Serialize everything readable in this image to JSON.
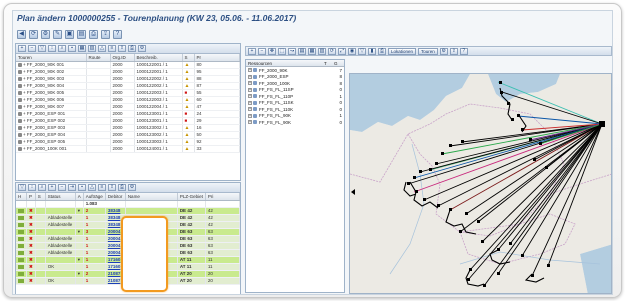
{
  "window": {
    "title": "Plan ändern 1000000255 - Tourenplanung (KW 23, 05.06. - 11.06.2017)"
  },
  "main_toolbar": {
    "buttons": [
      "back",
      "refresh",
      "settings",
      "tools",
      "save",
      "save-as",
      "print",
      "export",
      "help"
    ]
  },
  "tours_panel": {
    "headers": [
      "Touren",
      "Route",
      "Org.ID",
      "Beschreib.",
      "S",
      "Pr"
    ],
    "rows": [
      {
        "name": "FF_2000_90K 001",
        "route": "",
        "org": "2000",
        "desc": "1000122001 / 1",
        "status": "▲",
        "val": "80"
      },
      {
        "name": "FF_2000_90K 002",
        "route": "",
        "org": "2000",
        "desc": "1000122001 / 1",
        "status": "▲",
        "val": "95"
      },
      {
        "name": "FF_2000_90K 003",
        "route": "",
        "org": "2000",
        "desc": "1000122002 / 1",
        "status": "▲",
        "val": "88"
      },
      {
        "name": "FF_2000_90K 004",
        "route": "",
        "org": "2000",
        "desc": "1000122002 / 1",
        "status": "▲",
        "val": "87"
      },
      {
        "name": "FF_2000_90K 005",
        "route": "",
        "org": "2000",
        "desc": "1000122003 / 1",
        "status": "■",
        "val": "55"
      },
      {
        "name": "FF_2000_90K 006",
        "route": "",
        "org": "2000",
        "desc": "1000122003 / 1",
        "status": "▲",
        "val": "60"
      },
      {
        "name": "FF_2000_90K 007",
        "route": "",
        "org": "2000",
        "desc": "1000122004 / 1",
        "status": "▲",
        "val": "47"
      },
      {
        "name": "FF_2000_ESP 001",
        "route": "",
        "org": "2000",
        "desc": "1000123001 / 1",
        "status": "■",
        "val": "24"
      },
      {
        "name": "FF_2000_ESP 002",
        "route": "",
        "org": "2000",
        "desc": "1000123001 / 1",
        "status": "■",
        "val": "29"
      },
      {
        "name": "FF_2000_ESP 003",
        "route": "",
        "org": "2000",
        "desc": "1000123002 / 1",
        "status": "▲",
        "val": "16"
      },
      {
        "name": "FF_2000_ESP 004",
        "route": "",
        "org": "2000",
        "desc": "1000123002 / 1",
        "status": "▲",
        "val": "50"
      },
      {
        "name": "FF_2000_ESP 005",
        "route": "",
        "org": "2000",
        "desc": "1000123003 / 1",
        "status": "▲",
        "val": "92"
      },
      {
        "name": "FF_2000_100K 001",
        "route": "",
        "org": "2000",
        "desc": "1000124001 / 1",
        "status": "▲",
        "val": "33"
      }
    ]
  },
  "resources_panel": {
    "header": "Ressourcen",
    "header_cols": [
      "T",
      "G"
    ],
    "items": [
      {
        "name": "FF_2000_90K",
        "count": "7"
      },
      {
        "name": "FF_2000_ESP",
        "count": "8"
      },
      {
        "name": "FF_2000_100K",
        "count": "8"
      },
      {
        "name": "FF_FS_FL_11SP",
        "count": "0"
      },
      {
        "name": "FF_FS_FL_110P",
        "count": "1"
      },
      {
        "name": "FF_FS_FL_11SK",
        "count": "0"
      },
      {
        "name": "FF_FS_FL_110K",
        "count": "0"
      },
      {
        "name": "FF_FS_FL_90K",
        "count": "1"
      },
      {
        "name": "FF_FS_FL_90K",
        "count": "0"
      }
    ]
  },
  "map_toolbar": {
    "tabs": [
      "Lokationen",
      "Touren"
    ]
  },
  "orders_panel": {
    "headers": [
      "H",
      "P",
      "S",
      "Status",
      "A",
      "Aufträge",
      "Debitor",
      "Name",
      "PLZ-Gebiet",
      "Pri"
    ],
    "total": "1.083",
    "rows": [
      {
        "s": "",
        "status": "",
        "a": "2",
        "debitor": "38348",
        "plz": "DE 42",
        "pri": "42"
      },
      {
        "s": "",
        "status": "Abladestelle",
        "a": "1",
        "debitor": "38348",
        "plz": "DE 42",
        "pri": "42"
      },
      {
        "s": "",
        "status": "Abladestelle",
        "a": "1",
        "debitor": "38348",
        "plz": "DE 42",
        "pri": "42"
      },
      {
        "s": "",
        "status": "",
        "a": "3",
        "debitor": "20004",
        "plz": "DE 63",
        "pri": "63"
      },
      {
        "s": "",
        "status": "Abladestelle",
        "a": "1",
        "debitor": "20004",
        "plz": "DE 63",
        "pri": "63"
      },
      {
        "s": "",
        "status": "Abladestelle",
        "a": "1",
        "debitor": "20004",
        "plz": "DE 63",
        "pri": "63"
      },
      {
        "s": "",
        "status": "Abladestelle",
        "a": "1",
        "debitor": "20004",
        "plz": "DE 63",
        "pri": "63"
      },
      {
        "s": "",
        "status": "",
        "a": "1",
        "debitor": "17160",
        "plz": "AT 11",
        "pri": "11"
      },
      {
        "s": "",
        "status": "OK",
        "a": "1",
        "debitor": "17160",
        "plz": "AT 11",
        "pri": "11"
      },
      {
        "s": "",
        "status": "",
        "a": "2",
        "debitor": "21087",
        "plz": "AT 20",
        "pri": "20"
      },
      {
        "s": "",
        "status": "OK",
        "a": "1",
        "debitor": "21087",
        "plz": "AT 20",
        "pri": "20"
      }
    ]
  }
}
